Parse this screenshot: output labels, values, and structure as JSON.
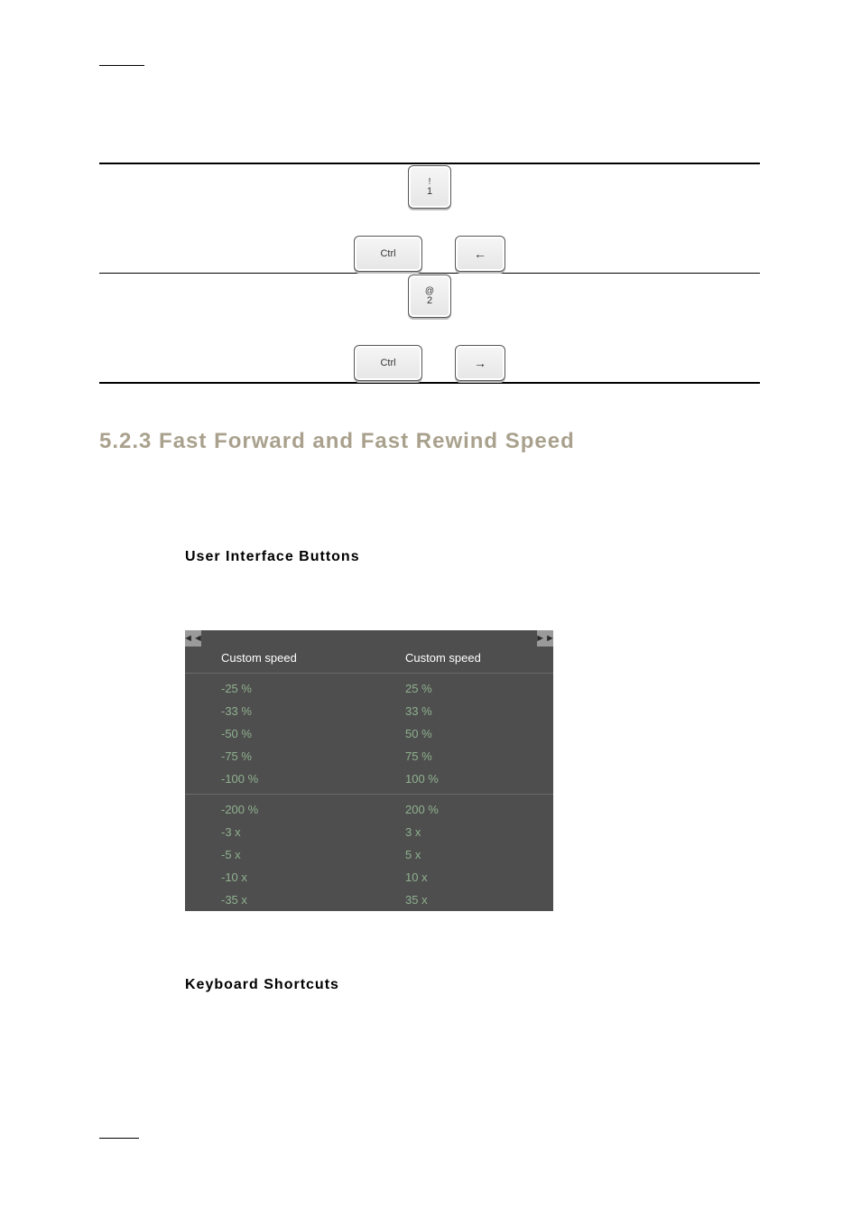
{
  "table_keys": {
    "row1_main_top": "!",
    "row1_main_bot": "1",
    "row1_alt_a": "Ctrl",
    "row1_alt_b": "←",
    "row2_main_top": "@",
    "row2_main_bot": "2",
    "row2_alt_a": "Ctrl",
    "row2_alt_b": "→"
  },
  "heading": "5.2.3  Fast Forward and Fast Rewind Speed",
  "subheading_ui": "User Interface Buttons",
  "subheading_kb": "Keyboard Shortcuts",
  "rewind_menu": {
    "icon": "◄◄",
    "header": "Custom speed",
    "group1": [
      "-25 %",
      "-33 %",
      "-50 %",
      "-75 %",
      "-100 %"
    ],
    "group2": [
      "-200 %",
      "-3 x",
      "-5 x",
      "-10 x",
      "-35 x"
    ]
  },
  "forward_menu": {
    "icon": "►►",
    "header": "Custom speed",
    "group1": [
      "25 %",
      "33 %",
      "50 %",
      "75 %",
      "100 %"
    ],
    "group2": [
      "200 %",
      "3 x",
      "5 x",
      "10 x",
      "35 x"
    ]
  }
}
